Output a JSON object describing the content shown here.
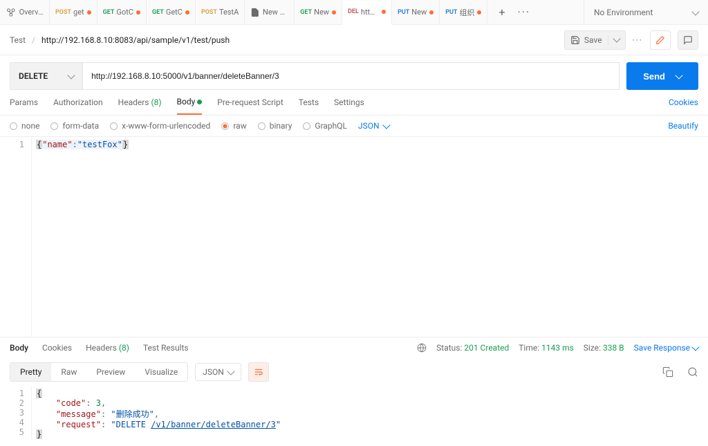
{
  "tabs": [
    {
      "kind": "overview",
      "label": "Overvie"
    },
    {
      "method": "POST",
      "mclass": "m-post",
      "label": "get",
      "dot": true
    },
    {
      "method": "GET",
      "mclass": "m-get",
      "label": "GotC",
      "dot": true
    },
    {
      "method": "GET",
      "mclass": "m-get",
      "label": "GetC",
      "dot": true
    },
    {
      "method": "POST",
      "mclass": "m-post",
      "label": "TestA",
      "dot": false
    },
    {
      "kind": "file",
      "label": "New Co"
    },
    {
      "method": "GET",
      "mclass": "m-get",
      "label": "New",
      "dot": true
    },
    {
      "method": "DEL",
      "mclass": "m-del",
      "label": "http:/",
      "dot": true,
      "active": true
    },
    {
      "method": "PUT",
      "mclass": "m-put",
      "label": "New",
      "dot": true
    },
    {
      "method": "PUT",
      "mclass": "m-put",
      "label": "组织",
      "dot": true
    }
  ],
  "env_label": "No Environment",
  "breadcrumb": {
    "root": "Test",
    "path": "http://192.168.8.10:8083/api/sample/v1/test/push"
  },
  "save_label": "Save",
  "request": {
    "method": "DELETE",
    "url": "http://192.168.8.10:5000/v1/banner/deleteBanner/3",
    "send": "Send"
  },
  "req_tabs": {
    "params": "Params",
    "auth": "Authorization",
    "headers": "Headers",
    "headers_count": "(8)",
    "body": "Body",
    "prereq": "Pre-request Script",
    "tests": "Tests",
    "settings": "Settings",
    "cookies": "Cookies"
  },
  "body_types": {
    "none": "none",
    "form": "form-data",
    "xwww": "x-www-form-urlencoded",
    "raw": "raw",
    "binary": "binary",
    "graphql": "GraphQL",
    "fmt": "JSON",
    "beautify": "Beautify"
  },
  "body_code": {
    "key": "\"name\"",
    "val": "\"testFox\""
  },
  "resp_tabs": {
    "body": "Body",
    "cookies": "Cookies",
    "headers": "Headers",
    "headers_count": "(8)",
    "tests": "Test Results"
  },
  "resp_meta": {
    "status_label": "Status:",
    "status_value": "201 Created",
    "time_label": "Time:",
    "time_value": "1143 ms",
    "size_label": "Size:",
    "size_value": "338 B",
    "save": "Save Response"
  },
  "resp_toolbar": {
    "pretty": "Pretty",
    "raw": "Raw",
    "preview": "Preview",
    "visualize": "Visualize",
    "fmt": "JSON"
  },
  "response_code": {
    "l2_key": "\"code\"",
    "l2_val": "3",
    "l3_key": "\"message\"",
    "l3_val": "\"删除成功\"",
    "l4_key": "\"request\"",
    "l4_val_a": "\"DELETE ",
    "l4_val_b": "/v1/banner/deleteBanner/3",
    "l4_val_c": "\""
  }
}
